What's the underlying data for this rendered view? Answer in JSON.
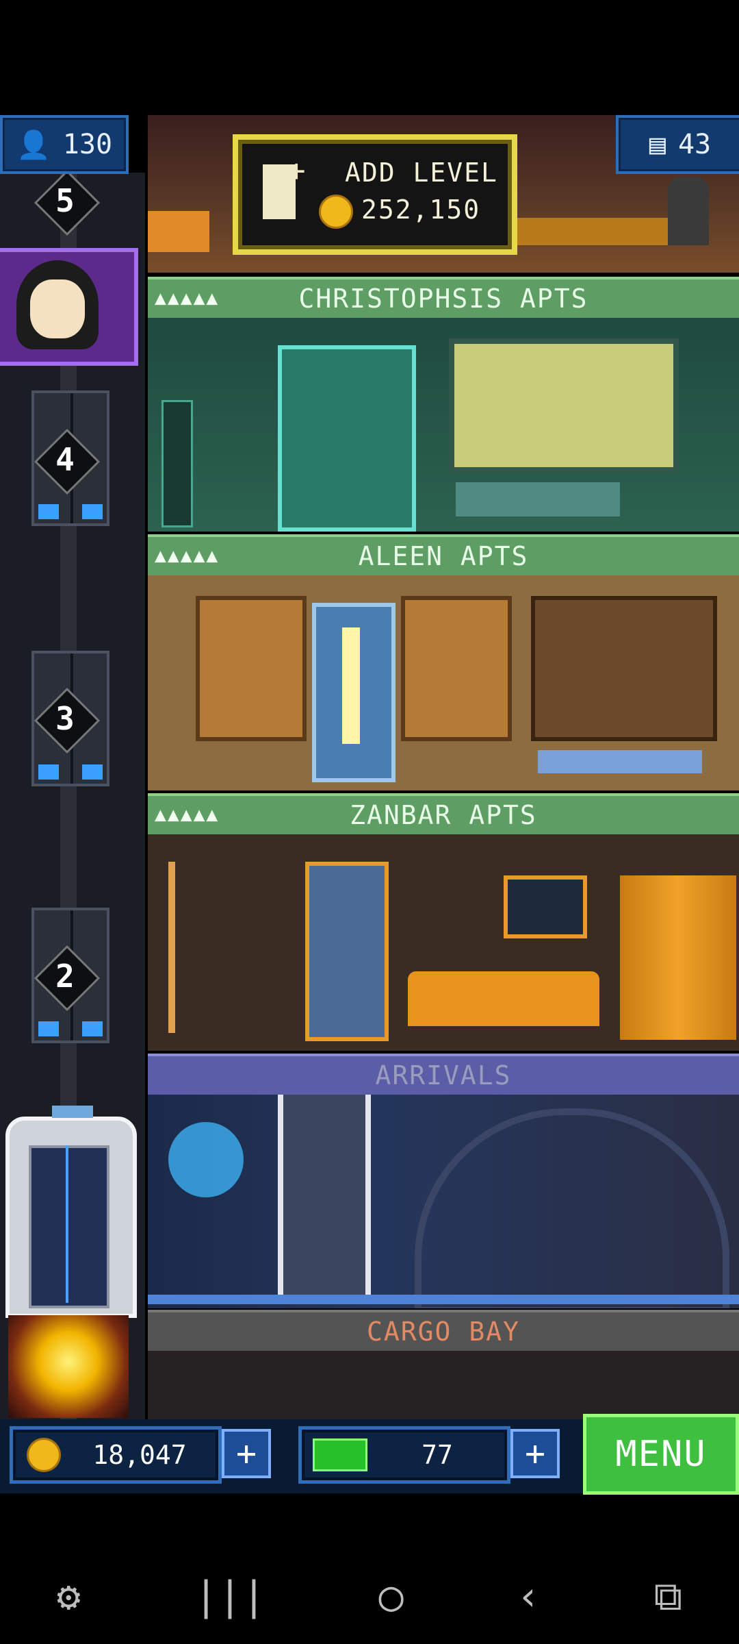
{
  "stats": {
    "population": "130",
    "floors": "43"
  },
  "add_level": {
    "label": "ADD LEVEL",
    "cost": "252,150"
  },
  "floors": [
    {
      "name": "CHRISTOPHSIS APTS",
      "stars": "▲▲▲▲▲"
    },
    {
      "name": "ALEEN APTS",
      "stars": "▲▲▲▲▲"
    },
    {
      "name": "ZANBAR APTS",
      "stars": "▲▲▲▲▲"
    },
    {
      "name": "ARRIVALS"
    },
    {
      "name": "CARGO BAY"
    }
  ],
  "elevator": {
    "floor_numbers": [
      "5",
      "4",
      "3",
      "2"
    ]
  },
  "resources": {
    "coins": "18,047",
    "bux": "77"
  },
  "menu_label": "MENU",
  "colors": {
    "apt_header": "#5e9d63",
    "arrivals_header": "#5b5ea6",
    "cargo_header": "#545454",
    "menu": "#3fbf3f",
    "panel": "#0d2342"
  }
}
